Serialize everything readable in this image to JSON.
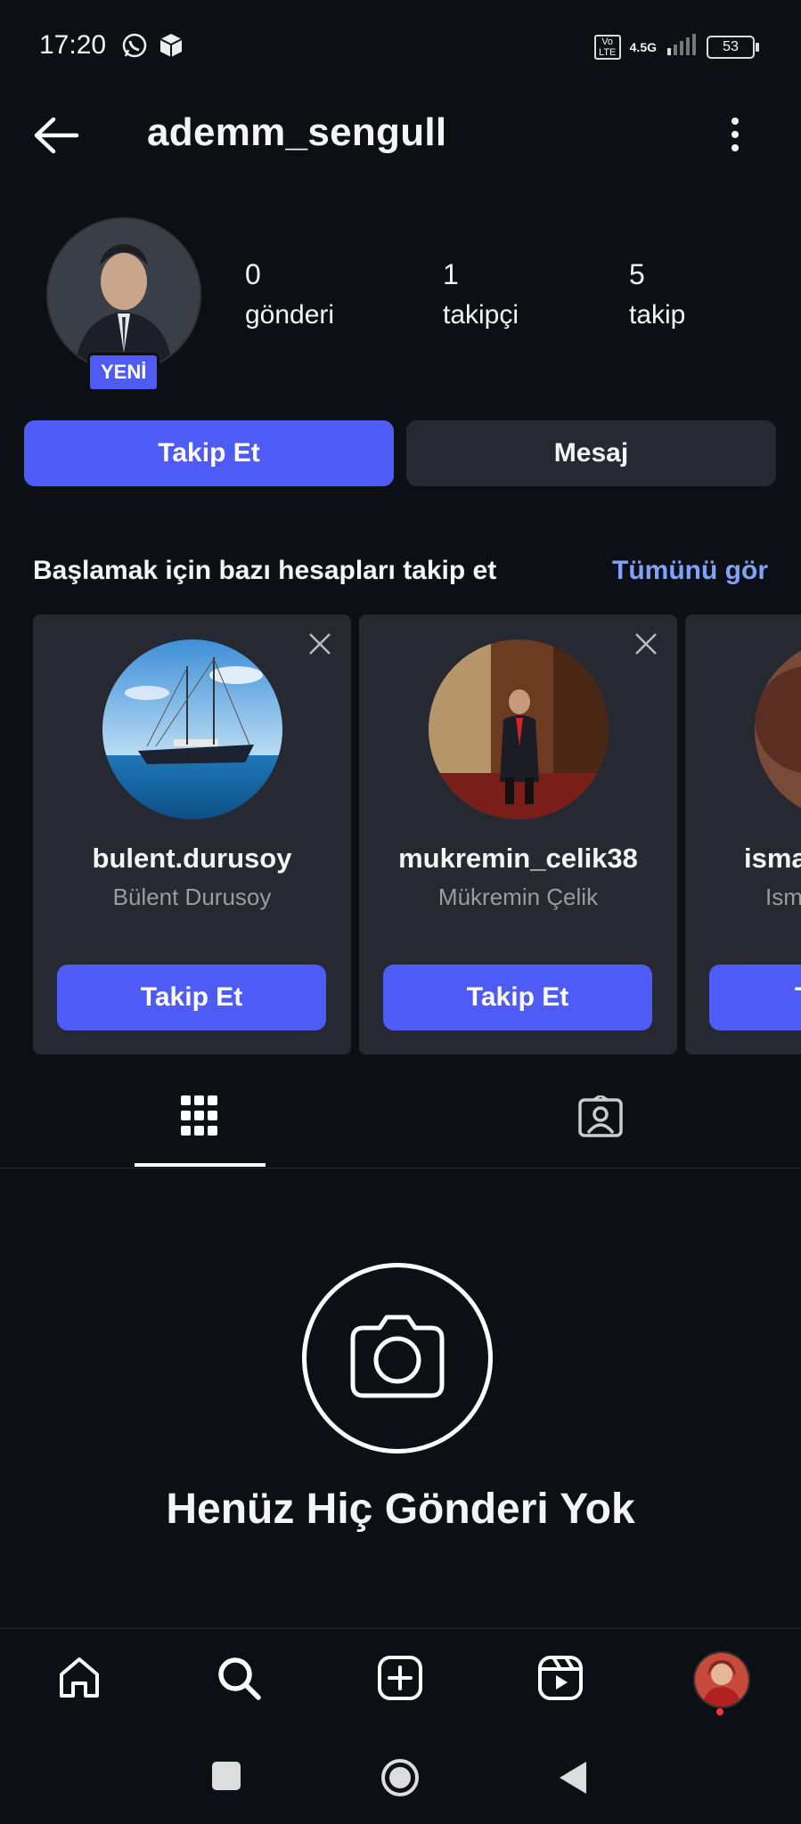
{
  "status_bar": {
    "time": "17:20",
    "network": "4.5G",
    "volte": "Vo LTE",
    "battery": "53"
  },
  "header": {
    "username": "ademm_sengull"
  },
  "profile": {
    "new_badge": "YENİ",
    "stats": [
      {
        "value": "0",
        "label": "gönderi"
      },
      {
        "value": "1",
        "label": "takipçi"
      },
      {
        "value": "5",
        "label": "takip"
      }
    ]
  },
  "actions": {
    "follow_label": "Takip Et",
    "message_label": "Mesaj"
  },
  "suggestions": {
    "title": "Başlamak için bazı hesapları takip et",
    "see_all": "Tümünü gör",
    "cards": [
      {
        "username": "bulent.durusoy",
        "full_name": "Bülent Durusoy",
        "button": "Takip Et"
      },
      {
        "username": "mukremin_celik38",
        "full_name": "Mükremin Çelik",
        "button": "Takip Et"
      },
      {
        "username": "isma",
        "full_name": "Ism",
        "button": "T"
      }
    ]
  },
  "empty_state": {
    "title": "Henüz Hiç Gönderi Yok"
  },
  "colors": {
    "background": "#0c0f14",
    "accent": "#4e5bf7",
    "card": "#262931",
    "link": "#7fa3ff"
  }
}
